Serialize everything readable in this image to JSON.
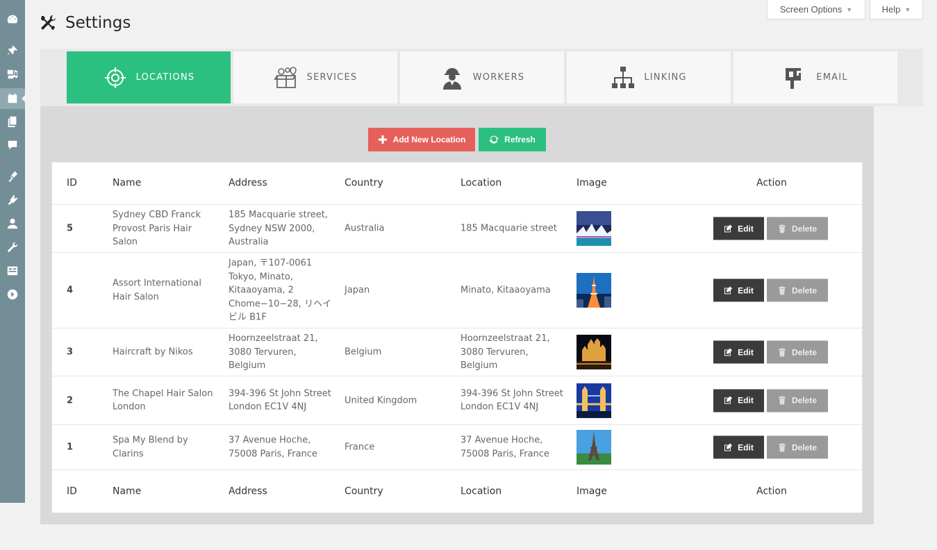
{
  "header": {
    "title": "Settings",
    "screen_options_label": "Screen Options",
    "help_label": "Help"
  },
  "tabs": [
    {
      "label": "LOCATIONS",
      "icon": "target-icon",
      "active": true
    },
    {
      "label": "SERVICES",
      "icon": "services-box-icon",
      "active": false
    },
    {
      "label": "WORKERS",
      "icon": "worker-icon",
      "active": false
    },
    {
      "label": "LINKING",
      "icon": "hierarchy-icon",
      "active": false
    },
    {
      "label": "EMAIL",
      "icon": "mailbox-icon",
      "active": false
    }
  ],
  "toolbar": {
    "add_label": "Add New Location",
    "refresh_label": "Refresh"
  },
  "table": {
    "columns": [
      "ID",
      "Name",
      "Address",
      "Country",
      "Location",
      "Image",
      "Action"
    ],
    "edit_label": "Edit",
    "delete_label": "Delete",
    "rows": [
      {
        "id": "5",
        "name": "Sydney CBD Franck Provost Paris Hair Salon",
        "address": "185 Macquarie street, Sydney NSW 2000, Australia",
        "country": "Australia",
        "location": "185 Macquarie street",
        "image": "sydney-opera-house-photo"
      },
      {
        "id": "4",
        "name": "Assort International Hair Salon",
        "address": "Japan, 〒107-0061 Tokyo, Minato, Kitaaoyama, 2 Chome−10−28, リヘイビル B1F",
        "country": "Japan",
        "location": "Minato, Kitaaoyama",
        "image": "tokyo-tower-photo"
      },
      {
        "id": "3",
        "name": "Haircraft by Nikos",
        "address": "Hoornzeelstraat 21, 3080 Tervuren, Belgium",
        "country": "Belgium",
        "location": "Hoornzeelstraat 21, 3080 Tervuren, Belgium",
        "image": "belgian-castle-photo"
      },
      {
        "id": "2",
        "name": "The Chapel Hair Salon London",
        "address": "394-396 St John Street London EC1V 4NJ",
        "country": "United Kingdom",
        "location": "394-396 St John Street London EC1V 4NJ",
        "image": "tower-bridge-photo"
      },
      {
        "id": "1",
        "name": "Spa My Blend by Clarins",
        "address": "37 Avenue Hoche, 75008 Paris, France",
        "country": "France",
        "location": "37 Avenue Hoche, 75008 Paris, France",
        "image": "eiffel-tower-photo"
      }
    ]
  },
  "colors": {
    "accent_green": "#2bc080",
    "add_red": "#e5605a",
    "sidebar": "#738e96"
  }
}
